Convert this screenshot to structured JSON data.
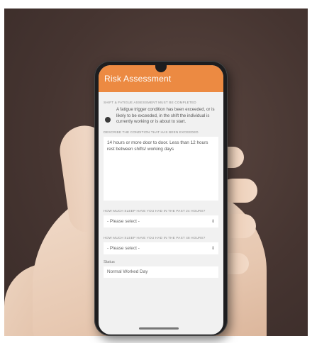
{
  "app": {
    "title": "Risk Assessment"
  },
  "section1": {
    "caption": "SHIFT & FATIGUE ASSESSMENT MUST BE COMPLETED",
    "option_text": "A fatigue trigger condition has been exceeded, or is likely to be exceeded, in the shift the individual is currently working or is about to start."
  },
  "section2": {
    "caption": "DESCRIBE THE CONDITION THAT HAS BEEN EXCEEDED",
    "value": "14 hours or more door to door. Less than 12 hours rest between shifts/ working days"
  },
  "select1": {
    "label": "HOW MUCH SLEEP HAVE YOU HAD IN THE PAST 24 HOURS?",
    "value": "- Please select -"
  },
  "select2": {
    "label": "HOW MUCH SLEEP HAVE YOU HAD IN THE PAST 48 HOURS?",
    "value": "- Please select -"
  },
  "status": {
    "label": "Status",
    "value": "Normal Worked Day"
  }
}
